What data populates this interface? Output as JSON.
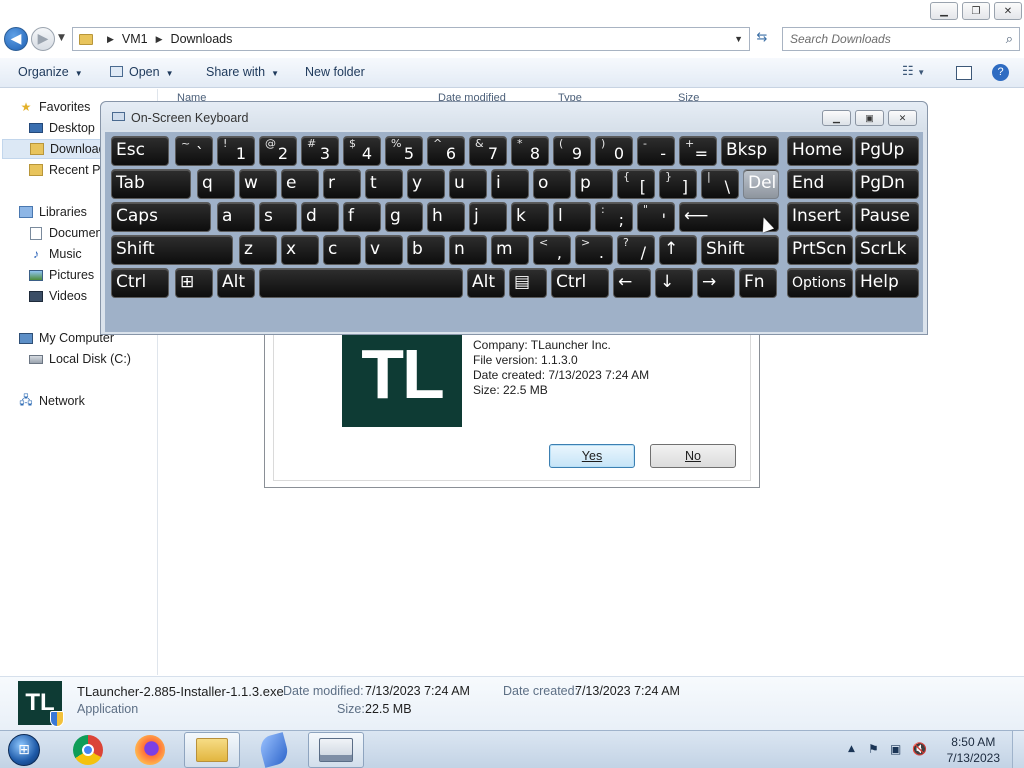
{
  "explorer": {
    "address": {
      "root": "VM1",
      "current": "Downloads"
    },
    "search_placeholder": "Search Downloads",
    "toolbar": {
      "organize": "Organize",
      "open": "Open",
      "share_with": "Share with",
      "new_folder": "New folder"
    },
    "nav": {
      "favorites": "Favorites",
      "desktop": "Desktop",
      "downloads": "Downloads",
      "recent": "Recent Places",
      "libraries": "Libraries",
      "documents": "Documents",
      "music": "Music",
      "pictures": "Pictures",
      "videos": "Videos",
      "my_computer": "My Computer",
      "local_disk": "Local Disk (C:)",
      "network": "Network"
    },
    "columns": {
      "name": "Name",
      "date_modified": "Date modified",
      "type": "Type",
      "size": "Size"
    },
    "details": {
      "icon_text": "TL",
      "filename": "TLauncher-2.885-Installer-1.1.3.exe",
      "type": "Application",
      "date_modified_label": "Date modified:",
      "date_modified": "7/13/2023 7:24 AM",
      "date_created_label": "Date created:",
      "date_created": "7/13/2023 7:24 AM",
      "size_label": "Size:",
      "size": "22.5 MB"
    }
  },
  "dialog": {
    "logo": "TL",
    "company": "Company: TLauncher Inc.",
    "file_version": "File version: 1.1.3.0",
    "date_created": "Date created: 7/13/2023 7:24 AM",
    "size": "Size: 22.5 MB",
    "yes": "Yes",
    "no": "No"
  },
  "osk": {
    "title": "On-Screen Keyboard",
    "rows": [
      [
        {
          "id": "esc",
          "label": "Esc"
        },
        {
          "id": "tilde",
          "top": "~",
          "bot": "`"
        },
        {
          "id": "1",
          "top": "!",
          "bot": "1"
        },
        {
          "id": "2",
          "top": "@",
          "bot": "2"
        },
        {
          "id": "3",
          "top": "#",
          "bot": "3"
        },
        {
          "id": "4",
          "top": "$",
          "bot": "4"
        },
        {
          "id": "5",
          "top": "%",
          "bot": "5"
        },
        {
          "id": "6",
          "top": "^",
          "bot": "6"
        },
        {
          "id": "7",
          "top": "&",
          "bot": "7"
        },
        {
          "id": "8",
          "top": "*",
          "bot": "8"
        },
        {
          "id": "9",
          "top": "(",
          "bot": "9"
        },
        {
          "id": "0",
          "top": ")",
          "bot": "0"
        },
        {
          "id": "minus",
          "top": "-",
          "bot": "-"
        },
        {
          "id": "equals",
          "top": "+",
          "bot": "="
        },
        {
          "id": "bksp",
          "label": "Bksp"
        },
        {
          "id": "home",
          "label": "Home"
        },
        {
          "id": "pgup",
          "label": "PgUp"
        }
      ],
      [
        {
          "id": "tab",
          "label": "Tab"
        },
        {
          "id": "q",
          "label": "q"
        },
        {
          "id": "w",
          "label": "w"
        },
        {
          "id": "e",
          "label": "e"
        },
        {
          "id": "r",
          "label": "r"
        },
        {
          "id": "t",
          "label": "t"
        },
        {
          "id": "y",
          "label": "y"
        },
        {
          "id": "u",
          "label": "u"
        },
        {
          "id": "i",
          "label": "i"
        },
        {
          "id": "o",
          "label": "o"
        },
        {
          "id": "p",
          "label": "p"
        },
        {
          "id": "lbracket",
          "top": "{",
          "bot": "["
        },
        {
          "id": "rbracket",
          "top": "}",
          "bot": "]"
        },
        {
          "id": "backslash",
          "top": "|",
          "bot": "\\"
        },
        {
          "id": "del",
          "label": "Del"
        },
        {
          "id": "end",
          "label": "End"
        },
        {
          "id": "pgdn",
          "label": "PgDn"
        }
      ],
      [
        {
          "id": "caps",
          "label": "Caps"
        },
        {
          "id": "a",
          "label": "a"
        },
        {
          "id": "s",
          "label": "s"
        },
        {
          "id": "d",
          "label": "d"
        },
        {
          "id": "f",
          "label": "f"
        },
        {
          "id": "g",
          "label": "g"
        },
        {
          "id": "h",
          "label": "h"
        },
        {
          "id": "j",
          "label": "j"
        },
        {
          "id": "k",
          "label": "k"
        },
        {
          "id": "l",
          "label": "l"
        },
        {
          "id": "semicolon",
          "top": ":",
          "bot": ";"
        },
        {
          "id": "quote",
          "top": "\"",
          "bot": "'"
        },
        {
          "id": "enter",
          "label": "⟵"
        },
        {
          "id": "insert",
          "label": "Insert"
        },
        {
          "id": "pause",
          "label": "Pause"
        }
      ],
      [
        {
          "id": "lshift",
          "label": "Shift"
        },
        {
          "id": "z",
          "label": "z"
        },
        {
          "id": "x",
          "label": "x"
        },
        {
          "id": "c",
          "label": "c"
        },
        {
          "id": "v",
          "label": "v"
        },
        {
          "id": "b",
          "label": "b"
        },
        {
          "id": "n",
          "label": "n"
        },
        {
          "id": "m",
          "label": "m"
        },
        {
          "id": "comma",
          "top": "<",
          "bot": ","
        },
        {
          "id": "period",
          "top": ">",
          "bot": "."
        },
        {
          "id": "slash",
          "top": "?",
          "bot": "/"
        },
        {
          "id": "up",
          "label": "↑"
        },
        {
          "id": "rshift",
          "label": "Shift"
        },
        {
          "id": "prtscn",
          "label": "PrtScn"
        },
        {
          "id": "scrlk",
          "label": "ScrLk"
        }
      ],
      [
        {
          "id": "lctrl",
          "label": "Ctrl"
        },
        {
          "id": "win",
          "label": "⊞"
        },
        {
          "id": "lalt",
          "label": "Alt"
        },
        {
          "id": "space",
          "label": ""
        },
        {
          "id": "ralt",
          "label": "Alt"
        },
        {
          "id": "menu",
          "label": "▤"
        },
        {
          "id": "rctrl",
          "label": "Ctrl"
        },
        {
          "id": "left",
          "label": "←"
        },
        {
          "id": "down",
          "label": "↓"
        },
        {
          "id": "right",
          "label": "→"
        },
        {
          "id": "fn",
          "label": "Fn"
        },
        {
          "id": "options",
          "label": "Options"
        },
        {
          "id": "help",
          "label": "Help"
        }
      ]
    ]
  },
  "taskbar": {
    "time": "8:50 AM",
    "date": "7/13/2023"
  }
}
